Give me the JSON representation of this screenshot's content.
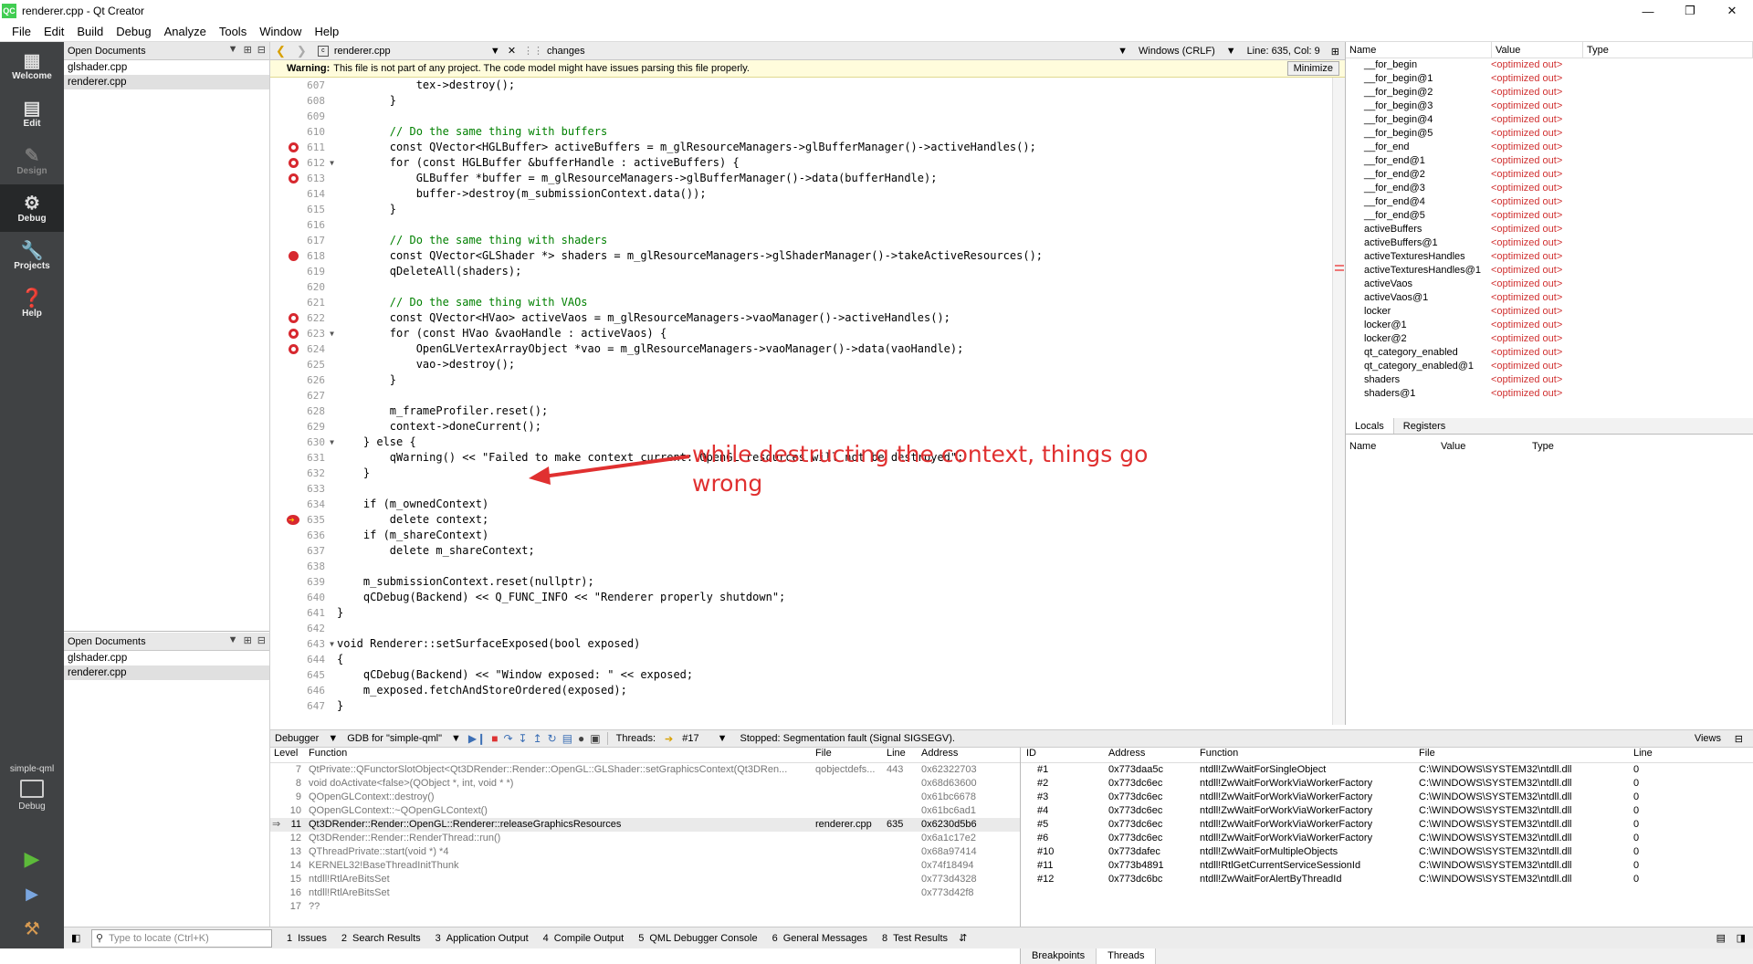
{
  "window": {
    "title": "renderer.cpp - Qt Creator",
    "icon_text": "QC"
  },
  "menu": [
    "File",
    "Edit",
    "Build",
    "Debug",
    "Analyze",
    "Tools",
    "Window",
    "Help"
  ],
  "modes": [
    {
      "label": "Welcome",
      "icon": "grid-icon"
    },
    {
      "label": "Edit",
      "icon": "edit-icon"
    },
    {
      "label": "Design",
      "icon": "pen-icon"
    },
    {
      "label": "Debug",
      "icon": "bug-icon"
    },
    {
      "label": "Projects",
      "icon": "wrench-icon"
    },
    {
      "label": "Help",
      "icon": "help-icon"
    }
  ],
  "kit": {
    "project": "simple-qml",
    "mode": "Debug"
  },
  "open_docs": {
    "title": "Open Documents",
    "files": [
      "glshader.cpp",
      "renderer.cpp"
    ]
  },
  "editor": {
    "file": "renderer.cpp",
    "changes": "changes",
    "line_ending": "Windows (CRLF)",
    "position": "Line: 635, Col: 9",
    "warning_bold": "Warning:",
    "warning_text": "This file is not part of any project. The code model might have issues parsing this file properly.",
    "minimize": "Minimize"
  },
  "code": [
    {
      "n": "607",
      "t": "            tex->destroy();"
    },
    {
      "n": "608",
      "t": "        }"
    },
    {
      "n": "609",
      "t": ""
    },
    {
      "n": "610",
      "t": "        // Do the same thing with buffers",
      "c": "cm"
    },
    {
      "n": "611",
      "t": "        const QVector<HGLBuffer> activeBuffers = m_glResourceManagers->glBufferManager()->activeHandles();",
      "bp": "ring"
    },
    {
      "n": "612",
      "t": "        for (const HGLBuffer &bufferHandle : activeBuffers) {",
      "bp": "ring",
      "fold": true
    },
    {
      "n": "613",
      "t": "            GLBuffer *buffer = m_glResourceManagers->glBufferManager()->data(bufferHandle);",
      "bp": "ring"
    },
    {
      "n": "614",
      "t": "            buffer->destroy(m_submissionContext.data());"
    },
    {
      "n": "615",
      "t": "        }"
    },
    {
      "n": "616",
      "t": ""
    },
    {
      "n": "617",
      "t": "        // Do the same thing with shaders",
      "c": "cm"
    },
    {
      "n": "618",
      "t": "        const QVector<GLShader *> shaders = m_glResourceManagers->glShaderManager()->takeActiveResources();",
      "bp": "full"
    },
    {
      "n": "619",
      "t": "        qDeleteAll(shaders);"
    },
    {
      "n": "620",
      "t": ""
    },
    {
      "n": "621",
      "t": "        // Do the same thing with VAOs",
      "c": "cm"
    },
    {
      "n": "622",
      "t": "        const QVector<HVao> activeVaos = m_glResourceManagers->vaoManager()->activeHandles();",
      "bp": "ring"
    },
    {
      "n": "623",
      "t": "        for (const HVao &vaoHandle : activeVaos) {",
      "bp": "ring",
      "fold": true
    },
    {
      "n": "624",
      "t": "            OpenGLVertexArrayObject *vao = m_glResourceManagers->vaoManager()->data(vaoHandle);",
      "bp": "ring"
    },
    {
      "n": "625",
      "t": "            vao->destroy();"
    },
    {
      "n": "626",
      "t": "        }"
    },
    {
      "n": "627",
      "t": ""
    },
    {
      "n": "628",
      "t": "        m_frameProfiler.reset();"
    },
    {
      "n": "629",
      "t": "        context->doneCurrent();"
    },
    {
      "n": "630",
      "t": "    } else {",
      "fold": true
    },
    {
      "n": "631",
      "t": "        qWarning() << \"Failed to make context current: OpenGL resources will not be destroyed\";"
    },
    {
      "n": "632",
      "t": "    }"
    },
    {
      "n": "633",
      "t": ""
    },
    {
      "n": "634",
      "t": "    if (m_ownedContext)"
    },
    {
      "n": "635",
      "t": "        delete context;",
      "bp": "cur"
    },
    {
      "n": "636",
      "t": "    if (m_shareContext)"
    },
    {
      "n": "637",
      "t": "        delete m_shareContext;"
    },
    {
      "n": "638",
      "t": ""
    },
    {
      "n": "639",
      "t": "    m_submissionContext.reset(nullptr);"
    },
    {
      "n": "640",
      "t": "    qCDebug(Backend) << Q_FUNC_INFO << \"Renderer properly shutdown\";"
    },
    {
      "n": "641",
      "t": "}"
    },
    {
      "n": "642",
      "t": ""
    },
    {
      "n": "643",
      "t": "void Renderer::setSurfaceExposed(bool exposed)",
      "fold": true
    },
    {
      "n": "644",
      "t": "{"
    },
    {
      "n": "645",
      "t": "    qCDebug(Backend) << \"Window exposed: \" << exposed;"
    },
    {
      "n": "646",
      "t": "    m_exposed.fetchAndStoreOrdered(exposed);"
    },
    {
      "n": "647",
      "t": "}"
    }
  ],
  "annotation": "while destructing the context, things go wrong",
  "locals": {
    "headers": [
      "Name",
      "Value",
      "Type"
    ],
    "rows": [
      [
        "__for_begin",
        "<optimized out>"
      ],
      [
        "__for_begin@1",
        "<optimized out>"
      ],
      [
        "__for_begin@2",
        "<optimized out>"
      ],
      [
        "__for_begin@3",
        "<optimized out>"
      ],
      [
        "__for_begin@4",
        "<optimized out>"
      ],
      [
        "__for_begin@5",
        "<optimized out>"
      ],
      [
        "__for_end",
        "<optimized out>"
      ],
      [
        "__for_end@1",
        "<optimized out>"
      ],
      [
        "__for_end@2",
        "<optimized out>"
      ],
      [
        "__for_end@3",
        "<optimized out>"
      ],
      [
        "__for_end@4",
        "<optimized out>"
      ],
      [
        "__for_end@5",
        "<optimized out>"
      ],
      [
        "activeBuffers",
        "<optimized out>"
      ],
      [
        "activeBuffers@1",
        "<optimized out>"
      ],
      [
        "activeTexturesHandles",
        "<optimized out>"
      ],
      [
        "activeTexturesHandles@1",
        "<optimized out>"
      ],
      [
        "activeVaos",
        "<optimized out>"
      ],
      [
        "activeVaos@1",
        "<optimized out>"
      ],
      [
        "locker",
        "<optimized out>"
      ],
      [
        "locker@1",
        "<optimized out>"
      ],
      [
        "locker@2",
        "<optimized out>"
      ],
      [
        "qt_category_enabled",
        "<optimized out>"
      ],
      [
        "qt_category_enabled@1",
        "<optimized out>"
      ],
      [
        "shaders",
        "<optimized out>"
      ],
      [
        "shaders@1",
        "<optimized out>"
      ]
    ],
    "tabs": [
      "Locals",
      "Registers"
    ],
    "lower_headers": [
      "Name",
      "Value",
      "Type"
    ]
  },
  "debugger": {
    "label": "Debugger",
    "engine": "GDB for \"simple-qml\"",
    "threads_label": "Threads:",
    "thread": "#17",
    "status": "Stopped: Segmentation fault (Signal SIGSEGV).",
    "views": "Views"
  },
  "stack": {
    "headers": [
      "Level",
      "Function",
      "File",
      "Line",
      "Address"
    ],
    "rows": [
      [
        "7",
        "QtPrivate::QFunctorSlotObject<Qt3DRender::Render::OpenGL::GLShader::setGraphicsContext(Qt3DRen...",
        "qobjectdefs...",
        "443",
        "0x62322703"
      ],
      [
        "8",
        "void doActivate<false>(QObject *, int, void * *)",
        "",
        "",
        "0x68d63600"
      ],
      [
        "9",
        "QOpenGLContext::destroy()",
        "",
        "",
        "0x61bc6678"
      ],
      [
        "10",
        "QOpenGLContext::~QOpenGLContext()",
        "",
        "",
        "0x61bc6ad1"
      ],
      [
        "11",
        "Qt3DRender::Render::OpenGL::Renderer::releaseGraphicsResources",
        "renderer.cpp",
        "635",
        "0x6230d5b6"
      ],
      [
        "12",
        "Qt3DRender::Render::RenderThread::run()",
        "",
        "",
        "0x6a1c17e2"
      ],
      [
        "13",
        "QThreadPrivate::start(void *) *4",
        "",
        "",
        "0x68a97414"
      ],
      [
        "14",
        "KERNEL32!BaseThreadInitThunk",
        "",
        "",
        "0x74f18494"
      ],
      [
        "15",
        "ntdll!RtlAreBitsSet",
        "",
        "",
        "0x773d4328"
      ],
      [
        "16",
        "ntdll!RtlAreBitsSet",
        "",
        "",
        "0x773d42f8"
      ],
      [
        "17",
        "??",
        "",
        "",
        ""
      ]
    ],
    "current": "11"
  },
  "threads": {
    "headers": [
      "ID",
      "Address",
      "Function",
      "File",
      "Line"
    ],
    "rows": [
      [
        "#1",
        "0x773daa5c",
        "ntdll!ZwWaitForSingleObject",
        "C:\\WINDOWS\\SYSTEM32\\ntdll.dll",
        "0"
      ],
      [
        "#2",
        "0x773dc6ec",
        "ntdll!ZwWaitForWorkViaWorkerFactory",
        "C:\\WINDOWS\\SYSTEM32\\ntdll.dll",
        "0"
      ],
      [
        "#3",
        "0x773dc6ec",
        "ntdll!ZwWaitForWorkViaWorkerFactory",
        "C:\\WINDOWS\\SYSTEM32\\ntdll.dll",
        "0"
      ],
      [
        "#4",
        "0x773dc6ec",
        "ntdll!ZwWaitForWorkViaWorkerFactory",
        "C:\\WINDOWS\\SYSTEM32\\ntdll.dll",
        "0"
      ],
      [
        "#5",
        "0x773dc6ec",
        "ntdll!ZwWaitForWorkViaWorkerFactory",
        "C:\\WINDOWS\\SYSTEM32\\ntdll.dll",
        "0"
      ],
      [
        "#6",
        "0x773dc6ec",
        "ntdll!ZwWaitForWorkViaWorkerFactory",
        "C:\\WINDOWS\\SYSTEM32\\ntdll.dll",
        "0"
      ],
      [
        "#10",
        "0x773dafec",
        "ntdll!ZwWaitForMultipleObjects",
        "C:\\WINDOWS\\SYSTEM32\\ntdll.dll",
        "0"
      ],
      [
        "#11",
        "0x773b4891",
        "ntdll!RtlGetCurrentServiceSessionId",
        "C:\\WINDOWS\\SYSTEM32\\ntdll.dll",
        "0"
      ],
      [
        "#12",
        "0x773dc6bc",
        "ntdll!ZwWaitForAlertByThreadId",
        "C:\\WINDOWS\\SYSTEM32\\ntdll.dll",
        "0"
      ]
    ],
    "tabs": [
      "Breakpoints",
      "Threads"
    ]
  },
  "statusbar": {
    "locator_placeholder": "Type to locate (Ctrl+K)",
    "tabs": [
      {
        "n": "1",
        "label": "Issues"
      },
      {
        "n": "2",
        "label": "Search Results"
      },
      {
        "n": "3",
        "label": "Application Output"
      },
      {
        "n": "4",
        "label": "Compile Output"
      },
      {
        "n": "5",
        "label": "QML Debugger Console"
      },
      {
        "n": "6",
        "label": "General Messages"
      },
      {
        "n": "8",
        "label": "Test Results"
      }
    ]
  }
}
